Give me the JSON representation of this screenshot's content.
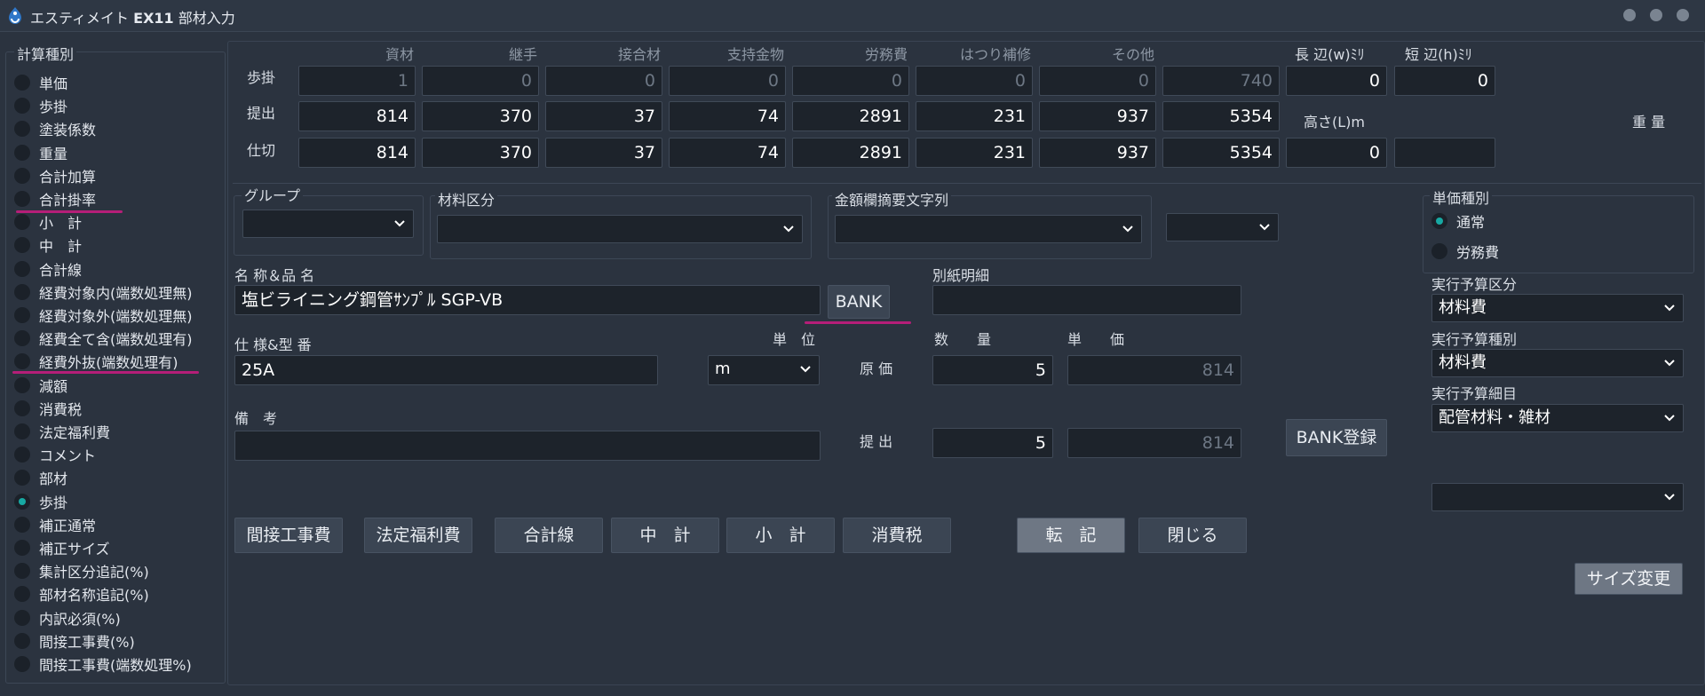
{
  "window": {
    "title_prefix": "エスティメイト",
    "title_product": "EX11",
    "title_suffix": "部材入力"
  },
  "calc_type": {
    "legend": "計算種別",
    "items": [
      "単価",
      "歩掛",
      "塗装係数",
      "重量",
      "合計加算",
      "合計掛率",
      "小　計",
      "中　計",
      "合計線",
      "経費対象内(端数処理無)",
      "経費対象外(端数処理無)",
      "経費全て含(端数処理有)",
      "経費外抜(端数処理有)",
      "減額",
      "消費税",
      "法定福利費",
      "コメント",
      "部材",
      "歩掛",
      "補正通常",
      "補正サイズ",
      "集計区分追記(%)",
      "部材名称追記(%)",
      "内訳必須(%)",
      "間接工事費(%)",
      "間接工事費(端数処理%)"
    ],
    "selected_index": 18
  },
  "grid": {
    "columns": [
      "資材",
      "継手",
      "接合材",
      "支持金物",
      "労務費",
      "はつり補修",
      "その他"
    ],
    "rows": [
      {
        "label": "歩掛",
        "values": [
          "1",
          "0",
          "0",
          "0",
          "0",
          "0",
          "0",
          "740"
        ]
      },
      {
        "label": "提出",
        "values": [
          "814",
          "370",
          "37",
          "74",
          "2891",
          "231",
          "937",
          "5354"
        ]
      },
      {
        "label": "仕切",
        "values": [
          "814",
          "370",
          "37",
          "74",
          "2891",
          "231",
          "937",
          "5354"
        ]
      }
    ]
  },
  "dims": {
    "long_label": "長 辺(w)ﾐﾘ",
    "long_value": "0",
    "short_label": "短 辺(h)ﾐﾘ",
    "short_value": "0",
    "height_label": "高さ(L)m",
    "height_value": "0",
    "weight_label": "重 量",
    "weight_value": ""
  },
  "group": {
    "legend": "グループ",
    "value": ""
  },
  "material_class": {
    "legend": "材料区分",
    "value": ""
  },
  "amount_summary": {
    "legend": "金額欄摘要文字列",
    "value": ""
  },
  "extra_select": {
    "value": ""
  },
  "unit_price_type": {
    "legend": "単価種別",
    "options": [
      "通常",
      "労務費"
    ],
    "selected_index": 0
  },
  "name": {
    "label": "名 称＆品 名",
    "value": "塩ビライニング鋼管ｻﾝﾌﾟﾙ SGP-VB"
  },
  "bank_button": "BANK",
  "separate_detail": {
    "label": "別紙明細",
    "value": ""
  },
  "spec": {
    "label": "仕 様&型 番",
    "value": "25A"
  },
  "unit": {
    "label": "単　位",
    "value": "m"
  },
  "quantity_header": "数　　量",
  "unit_price_header": "単　　価",
  "cost": {
    "label": "原 価",
    "quantity": "5",
    "unit_price": "814"
  },
  "submit": {
    "label": "提 出",
    "quantity": "5",
    "unit_price": "814"
  },
  "remarks": {
    "label": "備　考",
    "value": ""
  },
  "bank_register_button": "BANK登録",
  "exec_budget_class": {
    "label": "実行予算区分",
    "value": "材料費"
  },
  "exec_budget_type": {
    "label": "実行予算種別",
    "value": "材料費"
  },
  "exec_budget_detail": {
    "label": "実行予算細目",
    "value": "配管材料・雑材"
  },
  "bottom_select": {
    "value": ""
  },
  "buttons": {
    "indirect": "間接工事費",
    "welfare": "法定福利費",
    "total_line": "合計線",
    "mid_total": "中　計",
    "sub_total": "小　計",
    "tax": "消費税",
    "transfer": "転　記",
    "close": "閉じる",
    "resize": "サイズ変更"
  },
  "colors": {
    "background": "#2b333f",
    "field": "#1d232b",
    "accent": "#17a9a3",
    "annotation": "#b51e78"
  }
}
